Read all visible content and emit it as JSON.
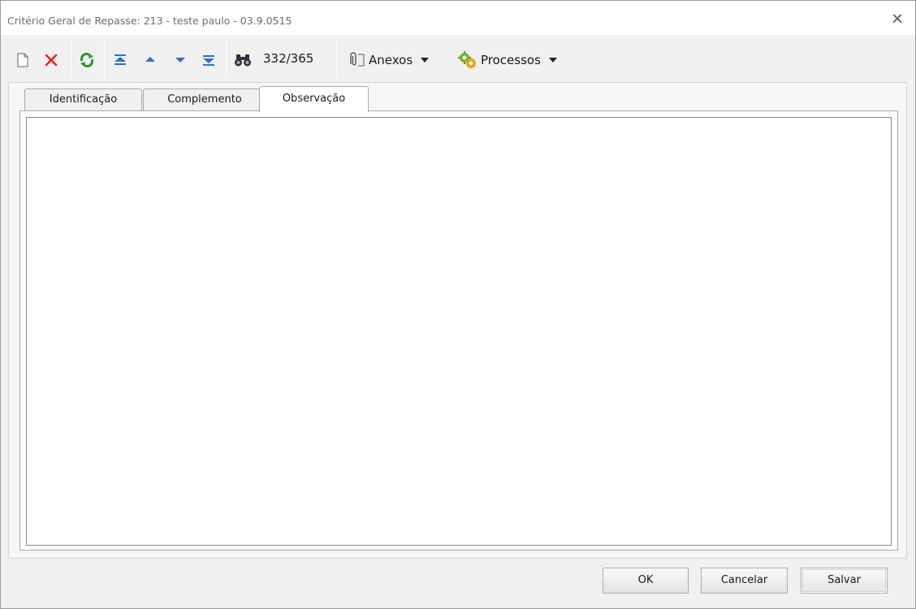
{
  "window": {
    "title": "Critério Geral de Repasse: 213 - teste paulo - 03.9.0515"
  },
  "toolbar": {
    "record_position": "332/365",
    "menus": {
      "attachments": "Anexos",
      "processes": "Processos"
    },
    "icons": [
      "new-record-icon",
      "delete-icon",
      "refresh-icon",
      "first-record-icon",
      "previous-record-icon",
      "next-record-icon",
      "last-record-icon",
      "search-binoculars-icon",
      "paperclip-icon",
      "processes-gear-icon"
    ]
  },
  "tabs": [
    {
      "label": "Identificação",
      "active": false
    },
    {
      "label": "Complemento",
      "active": false
    },
    {
      "label": "Observação",
      "active": true
    }
  ],
  "observation": {
    "value": ""
  },
  "buttons": {
    "ok": "OK",
    "cancel": "Cancelar",
    "save": "Salvar"
  },
  "colors": {
    "delete_red": "#e8231d",
    "refresh_green": "#2a9a2a",
    "nav_blue": "#2f6fd6"
  }
}
